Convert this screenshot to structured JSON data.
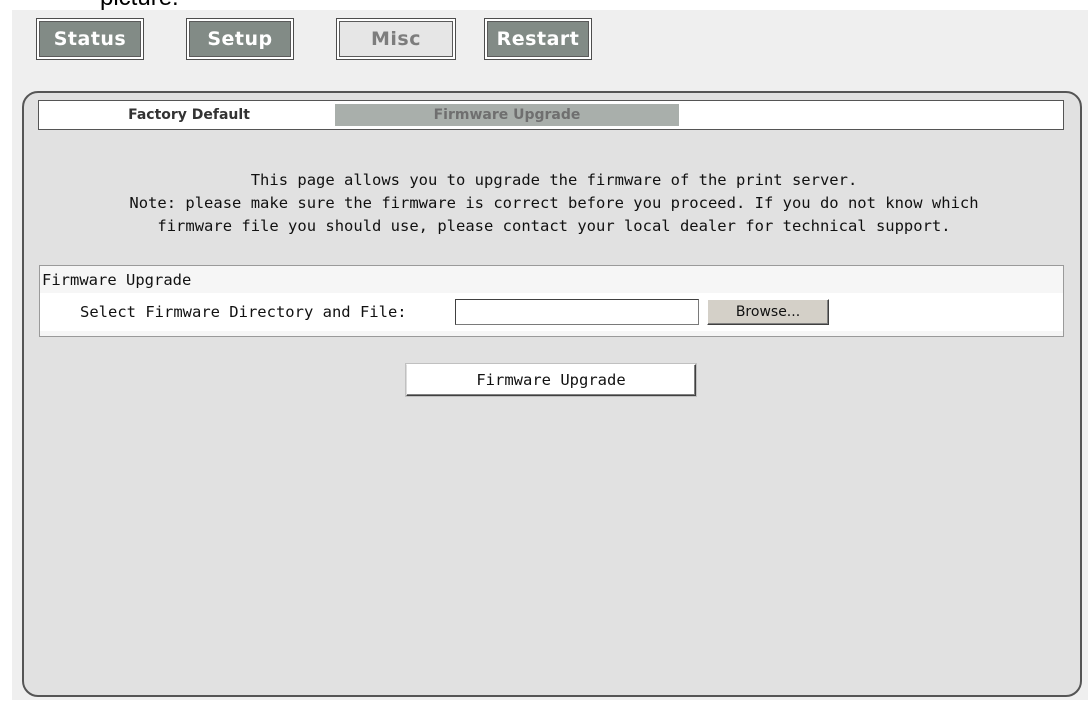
{
  "overlay_text": "picture.",
  "nav": {
    "items": [
      {
        "label": "Status"
      },
      {
        "label": "Setup"
      },
      {
        "label": "Misc",
        "active": true
      },
      {
        "label": "Restart"
      }
    ]
  },
  "subtabs": [
    {
      "label": "Factory Default"
    },
    {
      "label": "Firmware Upgrade",
      "active": true
    }
  ],
  "intro": {
    "line1": "This page allows you to upgrade the firmware of the print server.",
    "line2": "Note: please make sure the firmware is correct before you proceed. If you do not know which",
    "line3": "firmware file you should use, please contact your local dealer for technical support."
  },
  "firmware_section": {
    "heading": "Firmware Upgrade",
    "select_label": "Select Firmware Directory and File:",
    "file_value": "",
    "browse_label": "Browse..."
  },
  "upgrade_button_label": "Firmware Upgrade",
  "colors": {
    "nav_button_fill": "#828b86",
    "nav_active_fill": "#e6e6e6",
    "panel_bg": "#e1e1e1",
    "active_tab_bg": "#a9afab"
  }
}
